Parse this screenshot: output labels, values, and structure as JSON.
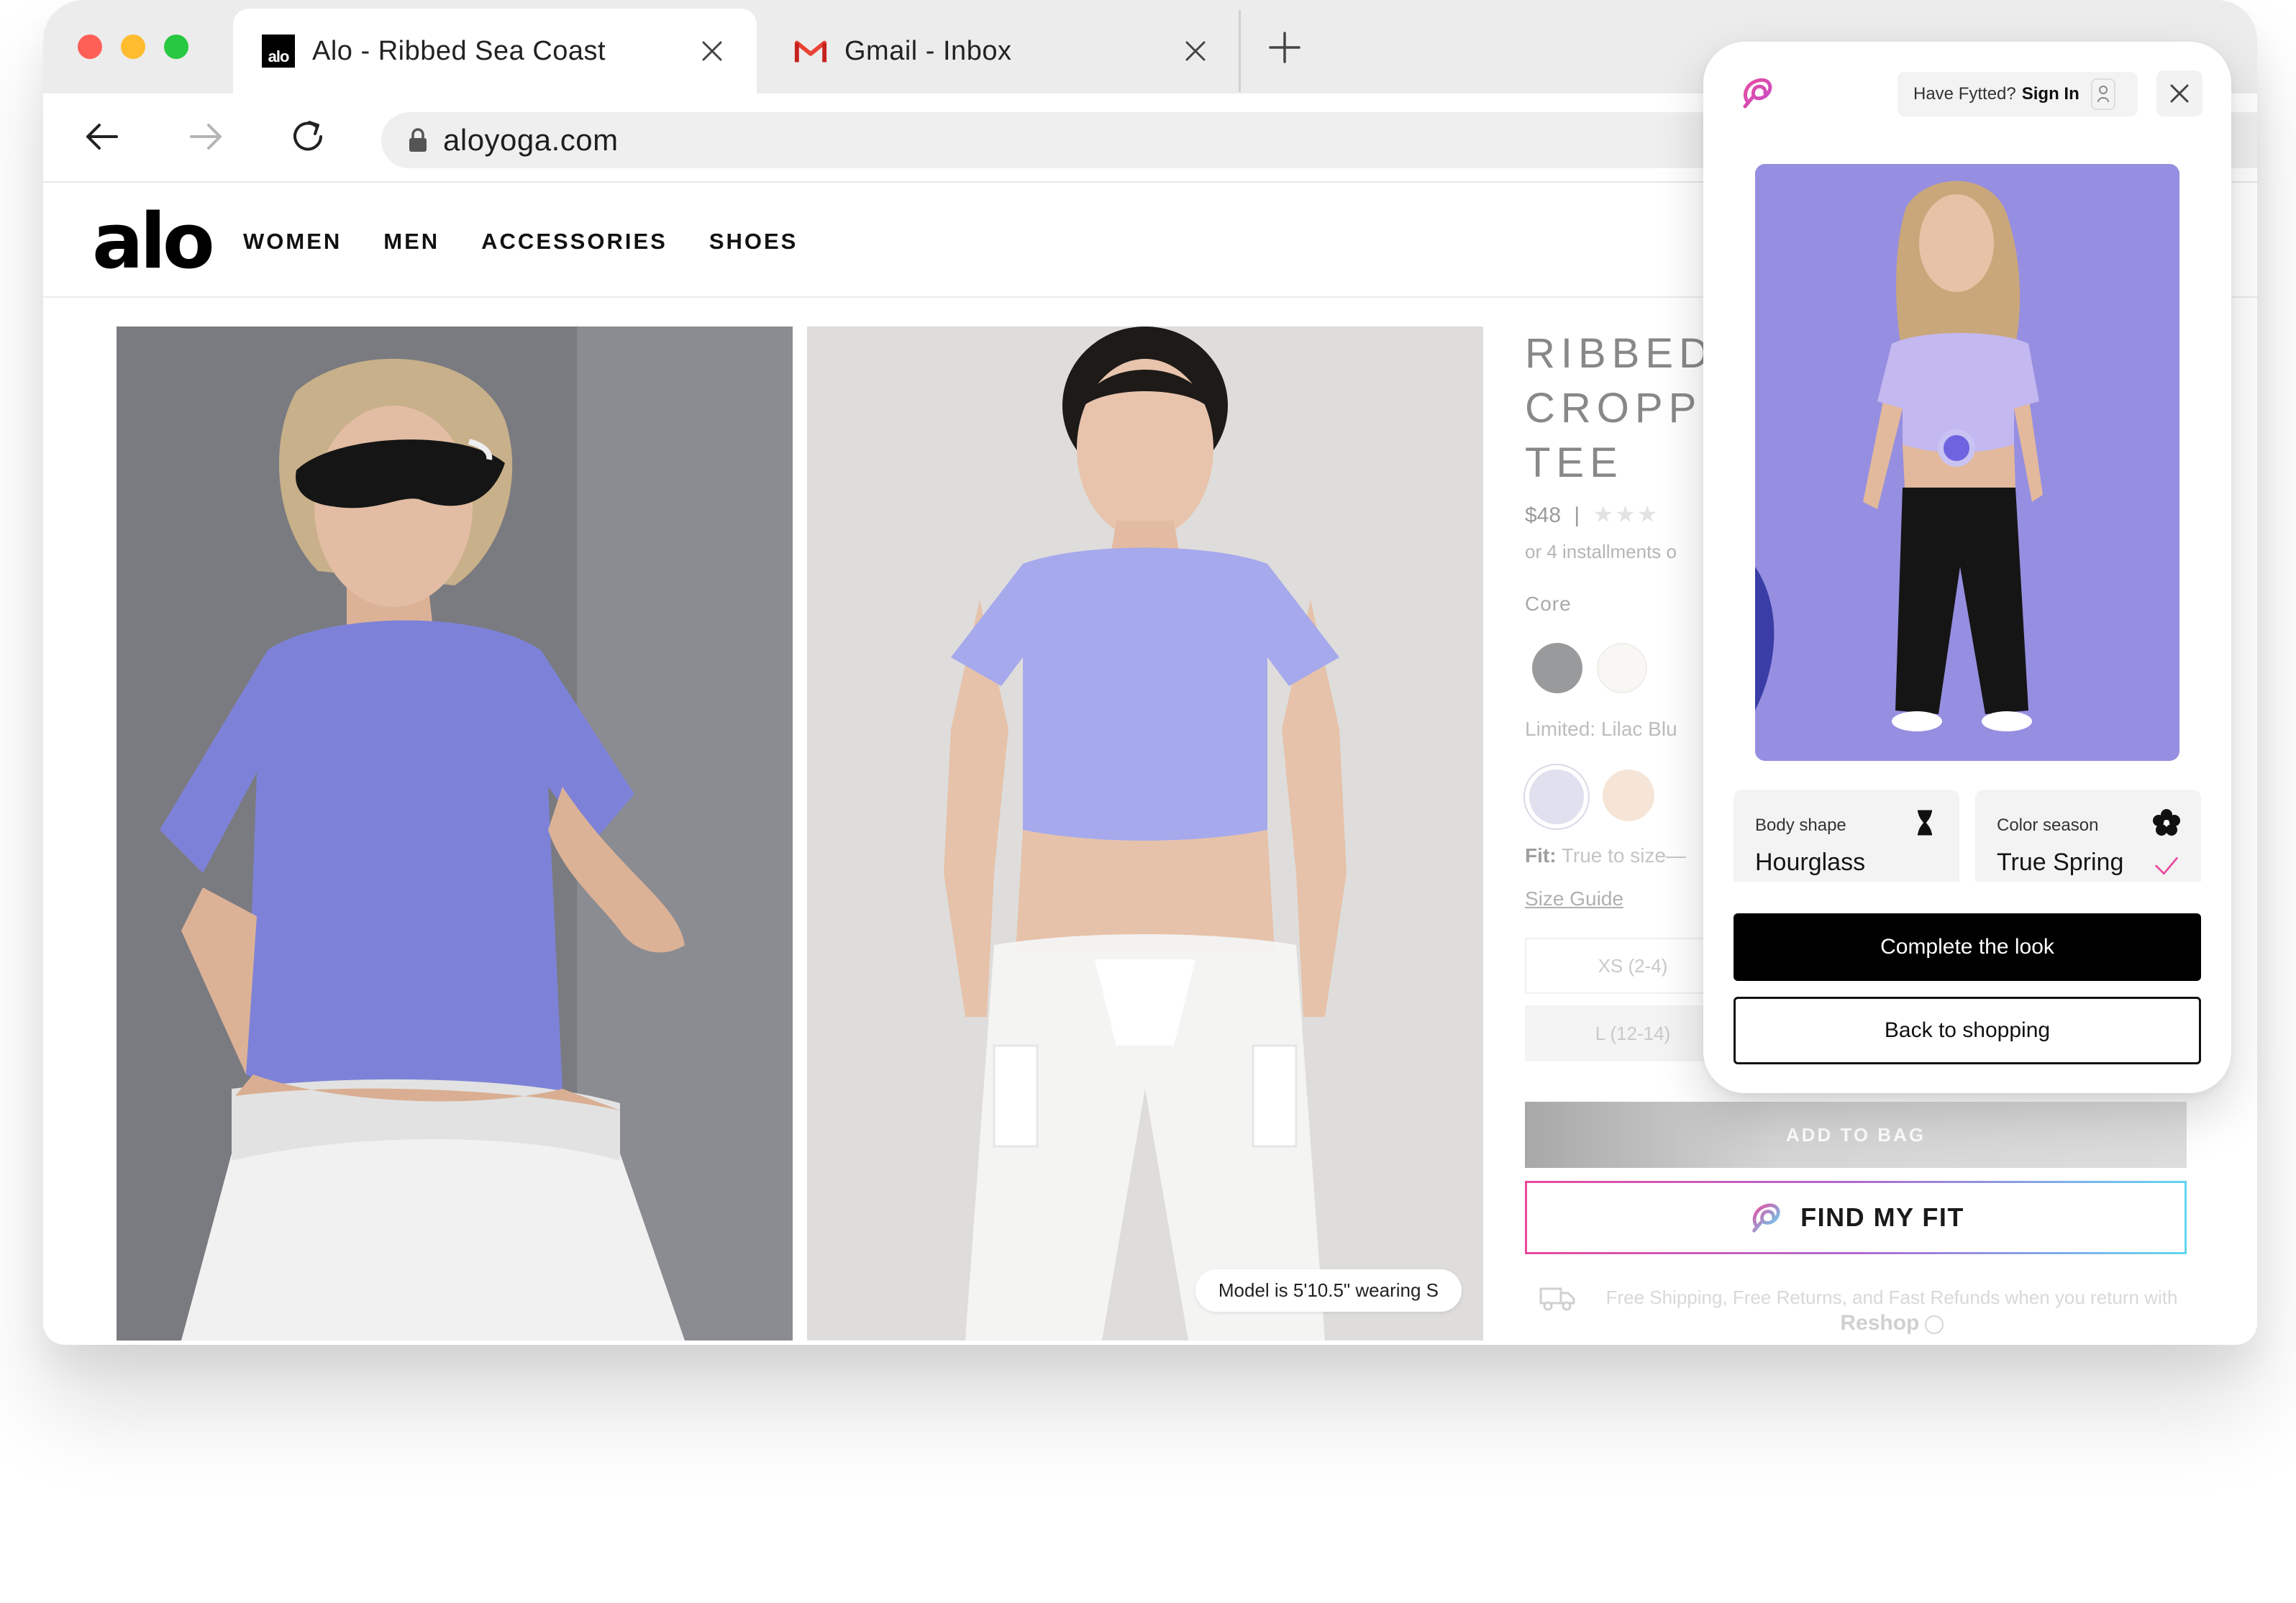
{
  "browser": {
    "tabs": [
      {
        "title": "Alo - Ribbed Sea Coast",
        "favicon": "alo-favicon",
        "active": true
      },
      {
        "title": "Gmail - Inbox",
        "favicon": "gmail-favicon",
        "active": false
      }
    ],
    "url": "aloyoga.com"
  },
  "site": {
    "logo": "alo",
    "nav": [
      "WOMEN",
      "MEN",
      "ACCESSORIES",
      "SHOES"
    ]
  },
  "product": {
    "title_lines": [
      "RIBBED",
      "CROPPE",
      "TEE"
    ],
    "price": "$48",
    "price_separator": "|",
    "rating_stars": "★★★",
    "installments": "or 4 installments o",
    "core_label": "Core",
    "limited_label": "Limited: Lilac Blu",
    "fit_label": "Fit:",
    "fit_value": "True to size—",
    "size_guide": "Size Guide",
    "sizes": [
      "XS (2-4)",
      "L (12-14)"
    ],
    "add_to_bag": "ADD TO BAG",
    "find_my_fit": "FIND MY FIT",
    "shipping_text": "Free Shipping, Free Returns, and Fast Refunds when you return with",
    "shipping_brand": "Reshop",
    "model_note": "Model is 5'10.5\" wearing S",
    "swatch_colors": [
      "#999a9c",
      "#f9f7f4",
      "#e0e0ef",
      "#f6e5d6"
    ]
  },
  "fytted": {
    "have_account": "Have Fytted?",
    "sign_in": "Sign In",
    "body_shape_label": "Body shape",
    "body_shape_value": "Hourglass",
    "color_season_label": "Color season",
    "color_season_value": "True Spring",
    "complete_look": "Complete the look",
    "back_to_shopping": "Back to shopping",
    "accent_gradient": [
      "#e94a9e",
      "#62d6f3"
    ]
  }
}
